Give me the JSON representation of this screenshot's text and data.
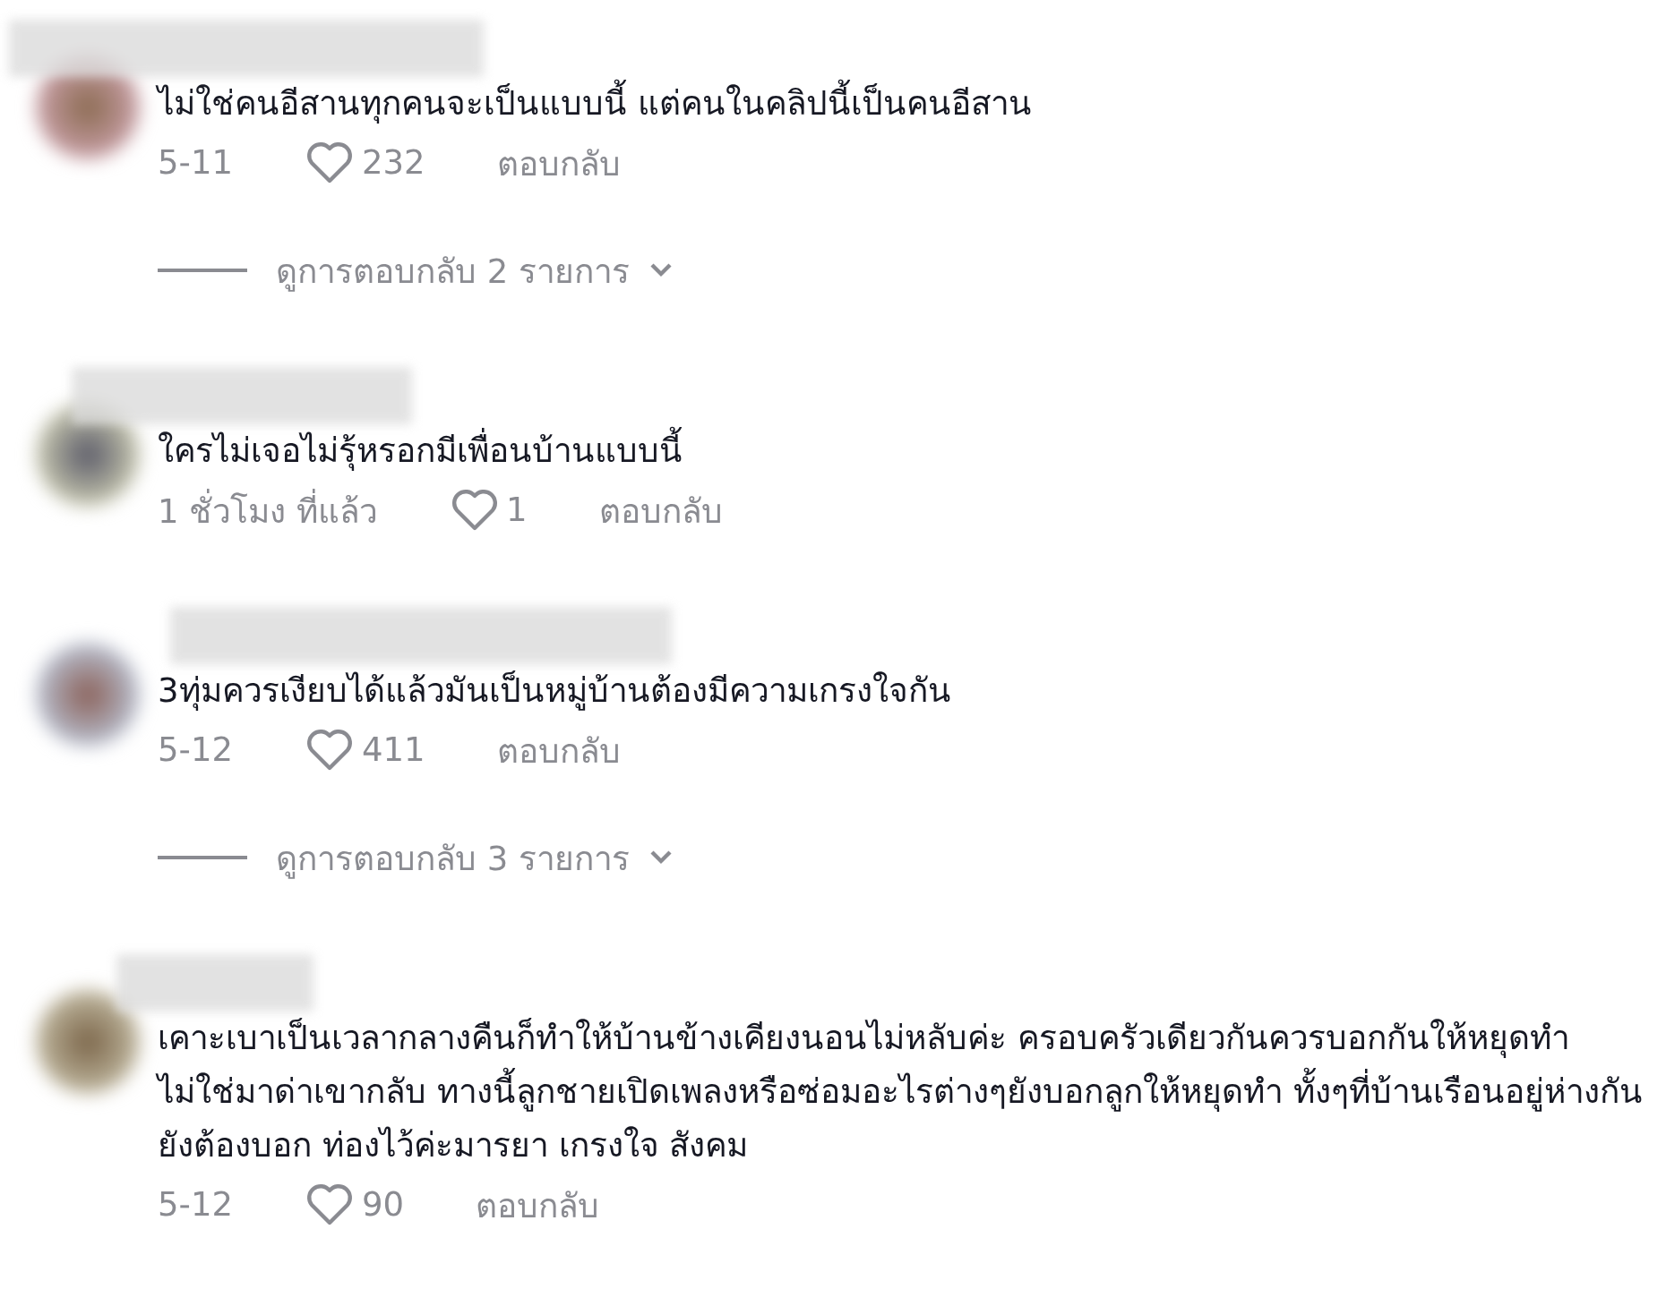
{
  "comments": [
    {
      "text": "ไม่ใช่คนอีสานทุกคนจะเป็นแบบนี้ แต่คนในคลิปนี้เป็นคนอีสาน",
      "time": "5-11",
      "likes": "232",
      "reply": "ตอบกลับ",
      "view_replies": "ดูการตอบกลับ 2 รายการ"
    },
    {
      "text": "ใครไม่เจอไม่รุ้หรอกมีเพื่อนบ้านแบบนี้",
      "time": "1 ชั่วโมง ที่แล้ว",
      "likes": "1",
      "reply": "ตอบกลับ"
    },
    {
      "text": "3ทุ่มควรเงียบได้แล้วมันเป็นหมู่บ้านต้องมีความเกรงใจกัน",
      "time": "5-12",
      "likes": "411",
      "reply": "ตอบกลับ",
      "view_replies": "ดูการตอบกลับ 3 รายการ"
    },
    {
      "text": "เคาะเบาเป็นเวลากลางคืนก็ทำให้บ้านข้างเคียงนอนไม่หลับค่ะ ครอบครัวเดียวกันควรบอกกันให้หยุดทำ ไม่ใช่มาด่าเขากลับ ทางนี้ลูกชายเปิดเพลงหรือซ่อมอะไรต่างๆยังบอกลูกให้หยุดทำ ทั้งๆที่บ้านเรือนอยู่ห่างกันยังต้องบอก ท่องไว้ค่ะมารยา เกรงใจ สังคม",
      "time": "5-12",
      "likes": "90",
      "reply": "ตอบกลับ"
    }
  ]
}
